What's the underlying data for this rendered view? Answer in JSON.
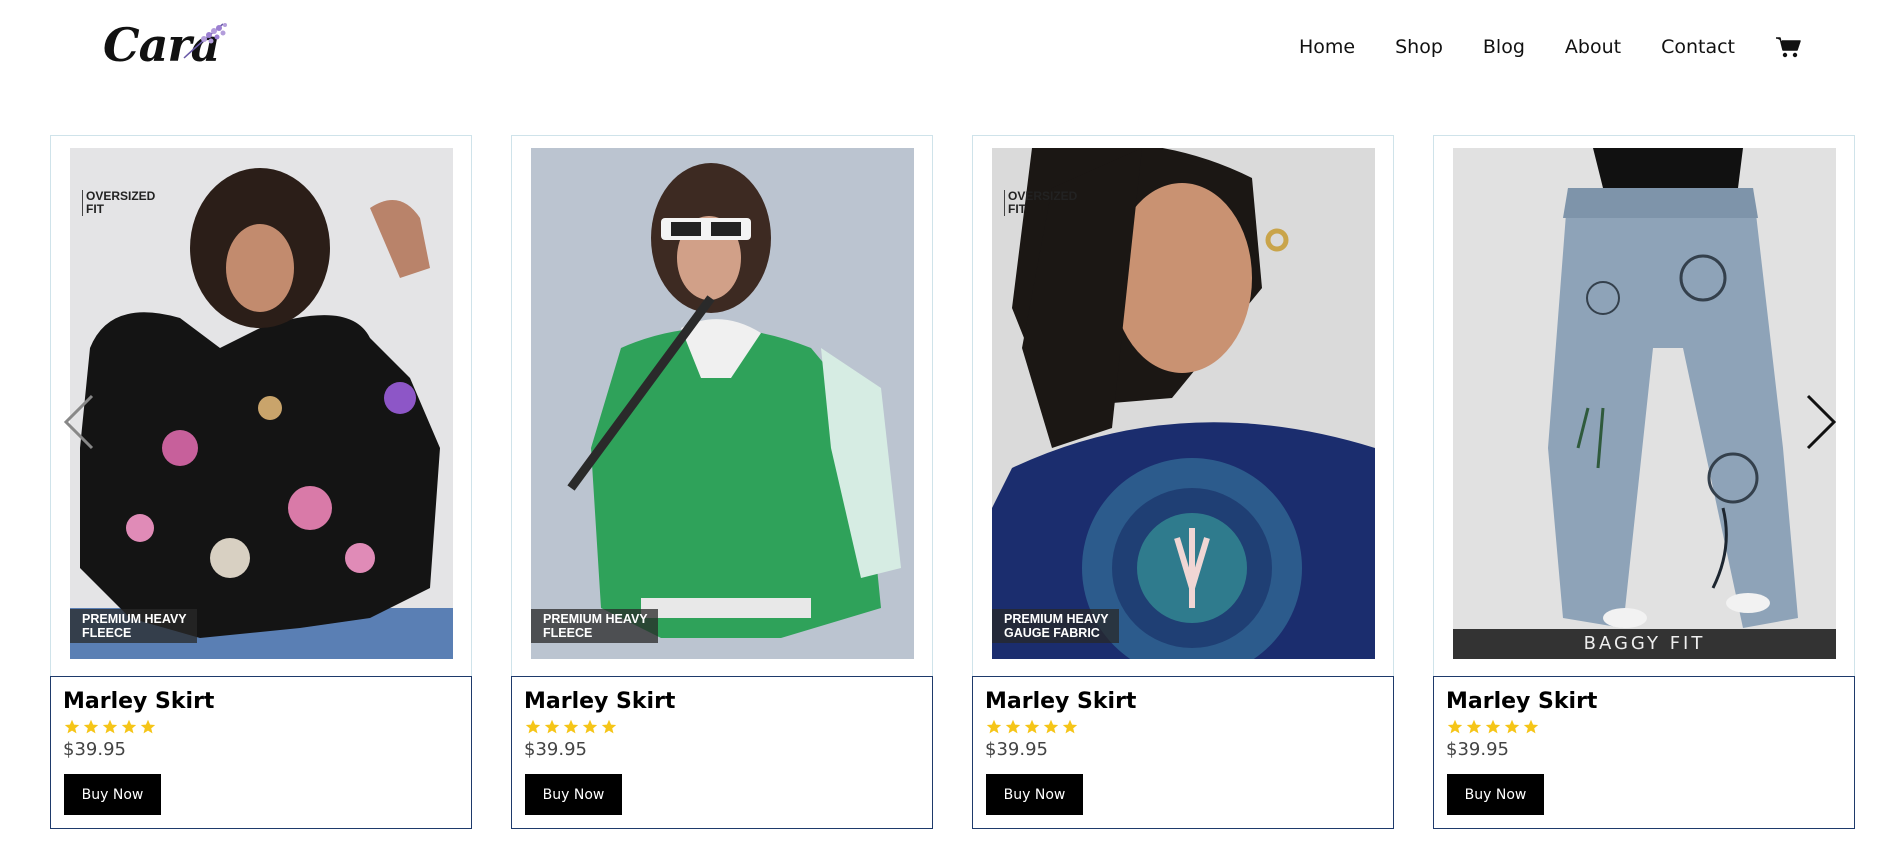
{
  "header": {
    "logo_text": "Cara",
    "nav": [
      "Home",
      "Shop",
      "Blog",
      "About",
      "Contact"
    ],
    "cart_icon": "cart-icon"
  },
  "products": [
    {
      "title": "Marley Skirt",
      "price": "$39.95",
      "rating": 5,
      "button": "Buy Now",
      "tag_top": "OVERSIZED\nFIT",
      "tag_bottom": "PREMIUM HEAVY\nFLEECE"
    },
    {
      "title": "Marley Skirt",
      "price": "$39.95",
      "rating": 5,
      "button": "Buy Now",
      "tag_bottom": "PREMIUM HEAVY\nFLEECE"
    },
    {
      "title": "Marley Skirt",
      "price": "$39.95",
      "rating": 5,
      "button": "Buy Now",
      "tag_top": "OVERSIZED\nFIT",
      "tag_bottom": "PREMIUM HEAVY\nGAUGE FABRIC"
    },
    {
      "title": "Marley Skirt",
      "price": "$39.95",
      "rating": 5,
      "button": "Buy Now",
      "tag_baggy": "BAGGY FIT"
    }
  ],
  "colors": {
    "star": "#f5c518",
    "button_bg": "#000000",
    "info_border": "#1e3a6b",
    "card_border": "#cfe3ea",
    "logo_accent": "#9b7fd1"
  },
  "icons": {
    "prev": "chevron-left-icon",
    "next": "chevron-right-icon"
  }
}
